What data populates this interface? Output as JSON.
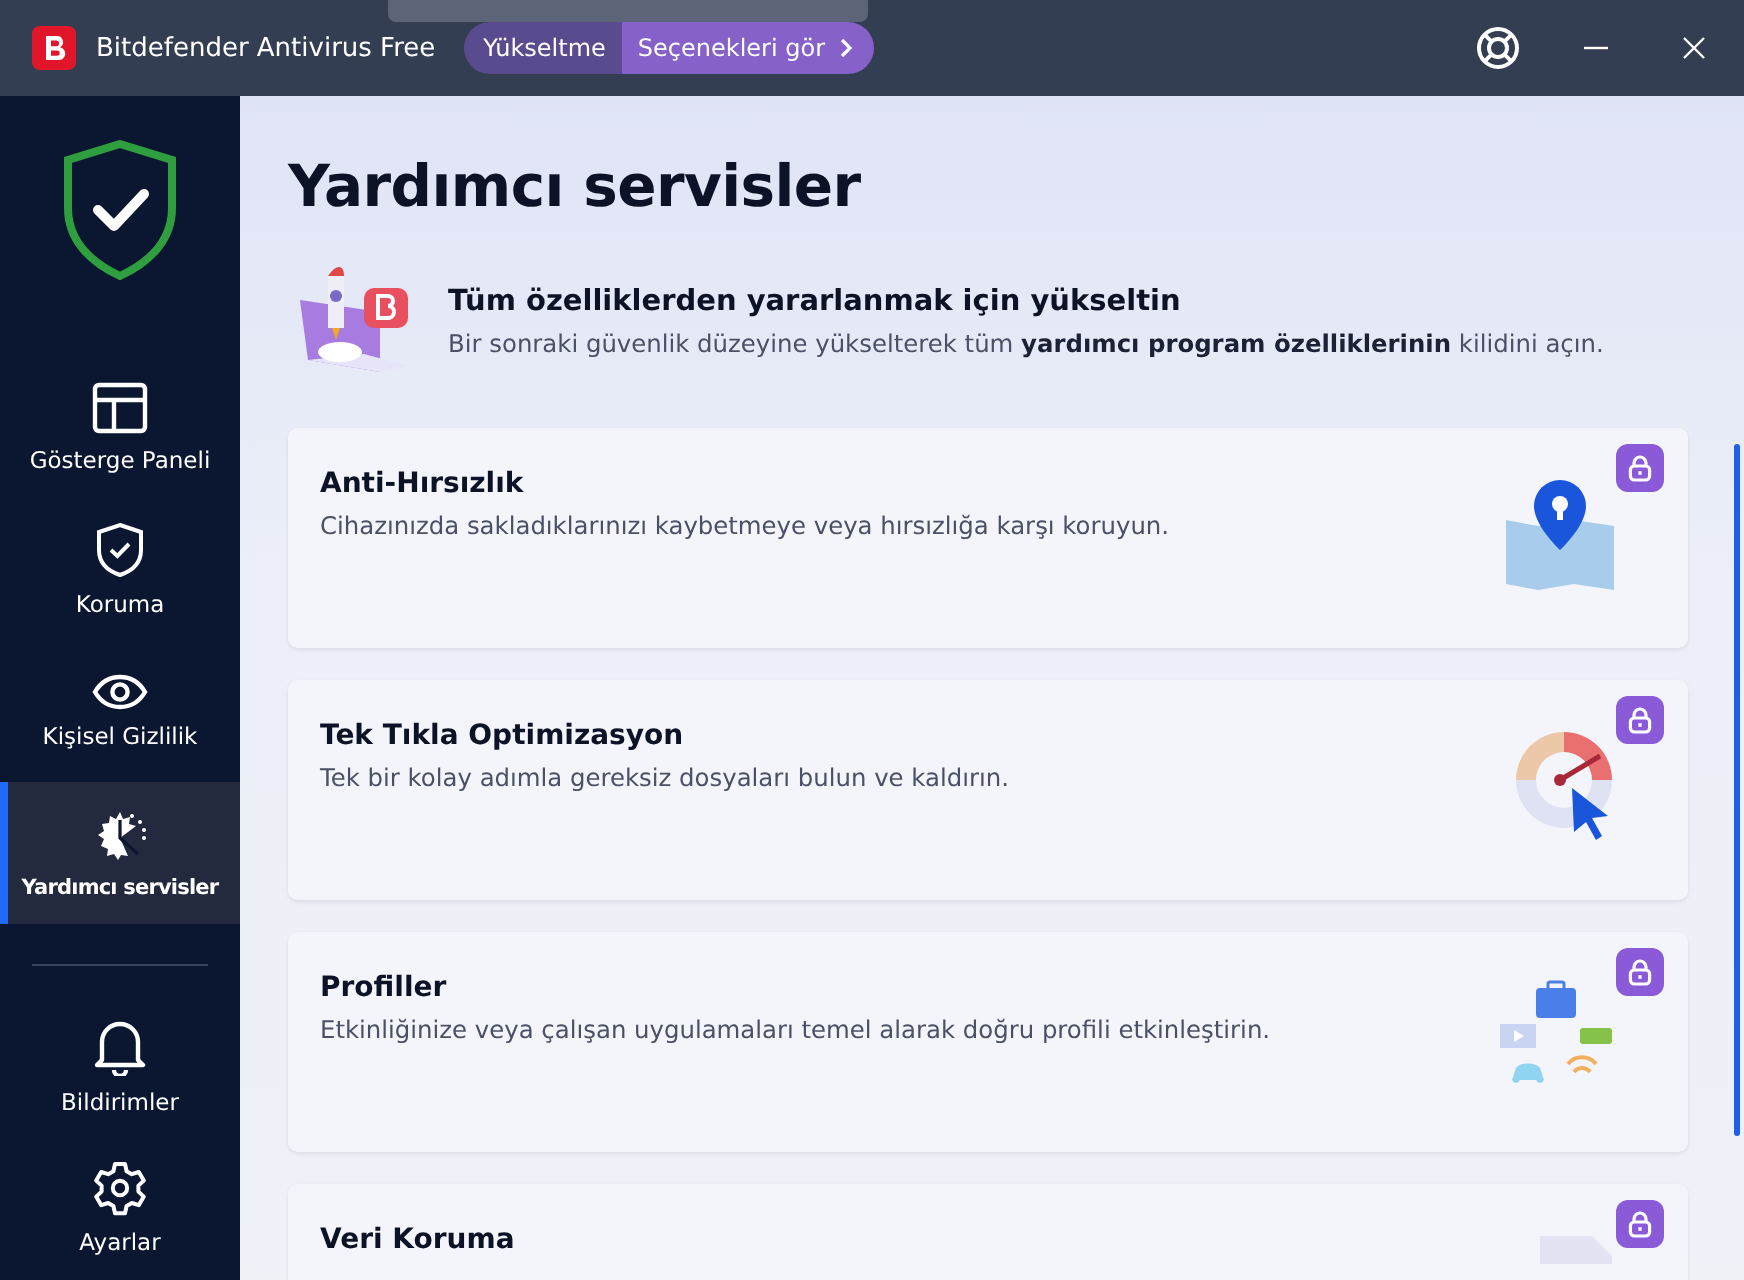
{
  "window": {
    "title": "Bitdefender Antivirus Free",
    "upgrade_label": "Yükseltme",
    "upgrade_button": "Seçenekleri gör"
  },
  "sidebar": {
    "items": [
      {
        "label": "Gösterge Paneli",
        "selected": false
      },
      {
        "label": "Koruma",
        "selected": false
      },
      {
        "label": "Kişisel Gizlilik",
        "selected": false
      },
      {
        "label": "Yardımcı servisler",
        "selected": true
      }
    ],
    "bottom_items": [
      {
        "label": "Bildirimler",
        "selected": false
      },
      {
        "label": "Ayarlar",
        "selected": false
      }
    ]
  },
  "page": {
    "title": "Yardımcı servisler"
  },
  "banner": {
    "title": "Tüm özelliklerden yararlanmak için yükseltin",
    "text": "Bir sonraki güvenlik düzeyine yükselterek tüm **yardımcı program özelliklerinin** kilidini açın."
  },
  "features": [
    {
      "title": "Anti-Hırsızlık",
      "description": "Cihazınızda sakladıklarınızı kaybetmeye veya hırsızlığa karşı koruyun.",
      "locked": true
    },
    {
      "title": "Tek Tıkla Optimizasyon",
      "description": "Tek bir kolay adımla gereksiz dosyaları bulun ve kaldırın.",
      "locked": true
    },
    {
      "title": "Profiller",
      "description": "Etkinliğinize veya çalışan uygulamaları temel alarak doğru profili etkinleştirin.",
      "locked": true
    },
    {
      "title": "Veri Koruma",
      "locked": true
    }
  ]
}
